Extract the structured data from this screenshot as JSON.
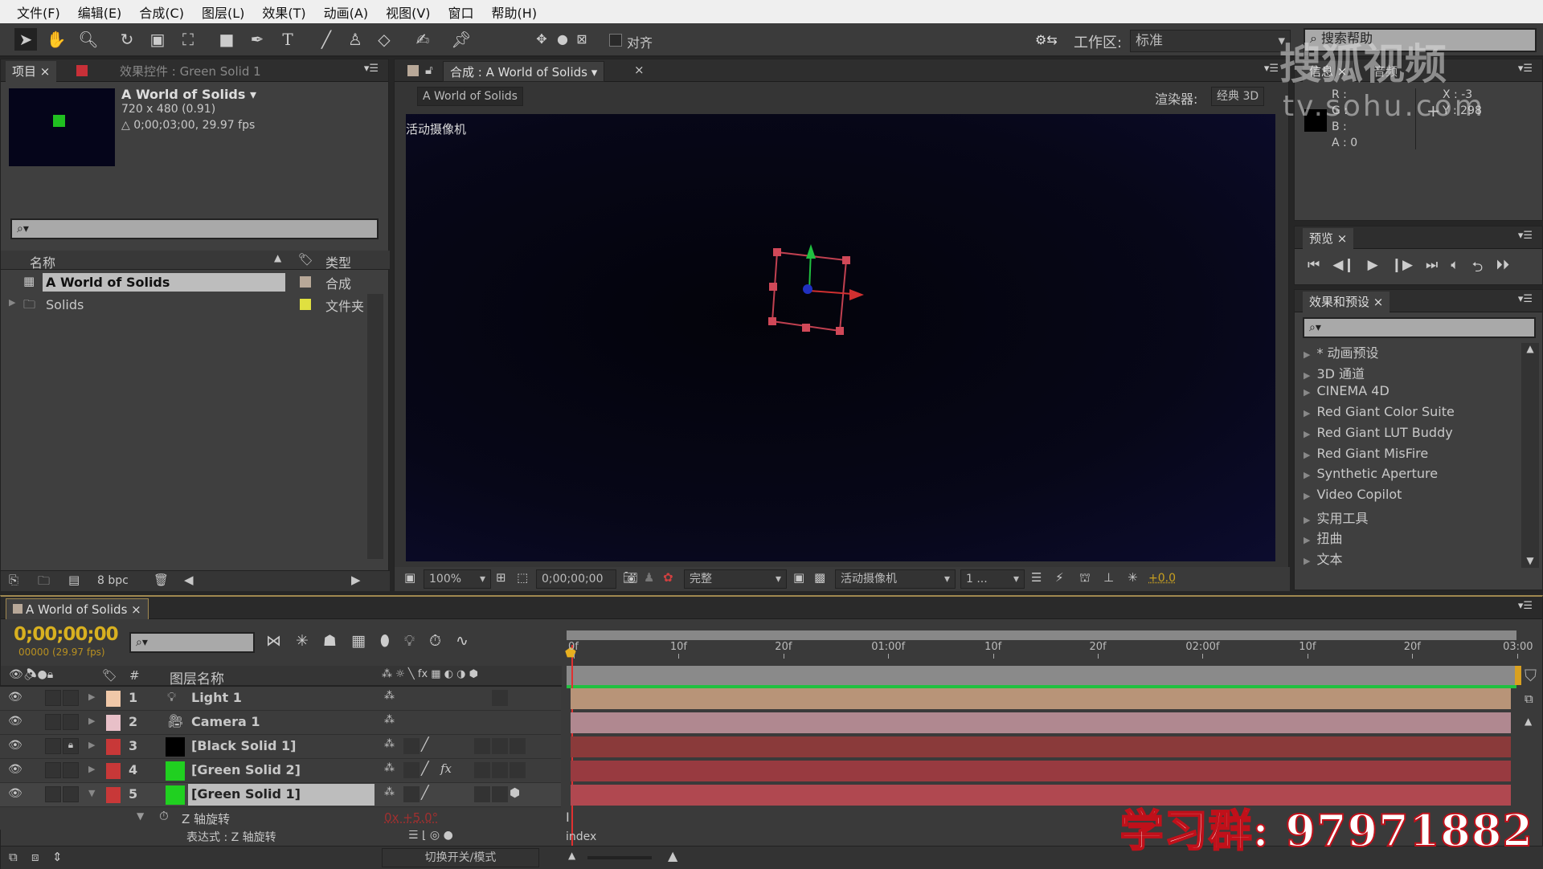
{
  "menu": [
    "文件(F)",
    "编辑(E)",
    "合成(C)",
    "图层(L)",
    "效果(T)",
    "动画(A)",
    "视图(V)",
    "窗口",
    "帮助(H)"
  ],
  "toolbar": {
    "snap_label": "对齐",
    "workspace_label": "工作区:",
    "workspace_value": "标准",
    "search_help_placeholder": "搜索帮助"
  },
  "project": {
    "tab": "项目",
    "effects_tab": "效果控件 : Green Solid 1",
    "comp_name": "A World of Solids ▾",
    "comp_size": "720 x 480 (0.91)",
    "comp_duration": "△ 0;00;03;00, 29.97 fps",
    "search_placeholder": "⌕▾",
    "col_name": "名称",
    "col_type": "类型",
    "items": [
      {
        "name": "A World of Solids",
        "type": "合成",
        "label_color": "#b8a898",
        "selected": true
      },
      {
        "name": "Solids",
        "type": "文件夹",
        "label_color": "#e0e040",
        "selected": false
      }
    ],
    "bpc": "8 bpc"
  },
  "viewer": {
    "tab": "合成 : A World of Solids",
    "breadcrumb": "A World of Solids",
    "renderer_label": "渲染器:",
    "renderer_value": "经典 3D",
    "camera_label": "活动摄像机",
    "zoom": "100%",
    "timecode": "0;00;00;00",
    "resolution": "完整",
    "view": "活动摄像机",
    "views_count": "1 ...",
    "exposure": "+0.0"
  },
  "info": {
    "tab": "信息",
    "audio_tab": "音频",
    "r": "R :",
    "g": "G :",
    "b": "B :",
    "a": "A : 0",
    "x": "X : -3",
    "y": "Y : 298"
  },
  "preview": {
    "tab": "预览"
  },
  "effects": {
    "tab": "效果和预设",
    "search_placeholder": "⌕▾",
    "items": [
      "* 动画预设",
      "3D 通道",
      "CINEMA 4D",
      "Red Giant Color Suite",
      "Red Giant LUT Buddy",
      "Red Giant MisFire",
      "Synthetic Aperture",
      "Video Copilot",
      "实用工具",
      "扭曲",
      "文本"
    ]
  },
  "timeline": {
    "tab": "A World of Solids",
    "timecode": "0;00;00;00",
    "frame_info": "00000 (29.97 fps)",
    "search_placeholder": "⌕▾",
    "col_num": "#",
    "col_layer_name": "图层名称",
    "ruler": [
      "0f",
      "10f",
      "20f",
      "01:00f",
      "10f",
      "20f",
      "02:00f",
      "10f",
      "20f",
      "03:00"
    ],
    "layers": [
      {
        "num": "1",
        "name": "Light 1",
        "label_color": "#f0c8a8",
        "icon": "light-icon",
        "bar_color": "#b89478",
        "locked": false,
        "fx": false
      },
      {
        "num": "2",
        "name": "Camera 1",
        "label_color": "#e8c0c8",
        "icon": "camera-icon",
        "bar_color": "#b08890",
        "locked": false,
        "fx": false
      },
      {
        "num": "3",
        "name": "[Black Solid 1]",
        "label_color": "#c83838",
        "swatch": "#000000",
        "bar_color": "#8a3a3a",
        "locked": true,
        "fx": false
      },
      {
        "num": "4",
        "name": "[Green Solid 2]",
        "label_color": "#c83838",
        "swatch": "#20d020",
        "bar_color": "#983a40",
        "locked": false,
        "fx": true
      },
      {
        "num": "5",
        "name": "[Green Solid 1]",
        "label_color": "#c83838",
        "swatch": "#20d020",
        "bar_color": "#b04850",
        "locked": false,
        "fx": false,
        "selected": true
      }
    ],
    "property_name": "Z 轴旋转",
    "property_value": "0x +5.0°",
    "expression_label": "表达式 : Z 轴旋转",
    "expression_text": "index",
    "toggle_label": "切换开关/模式"
  },
  "watermarks": {
    "sohu": "搜狐视频",
    "sohu_url": "tv.sohu.com",
    "qq_group": "学习群: 97971882"
  },
  "colors": {
    "accent_timecode": "#d8b020",
    "playhead": "#e8b020",
    "work_area": "#20c040"
  }
}
